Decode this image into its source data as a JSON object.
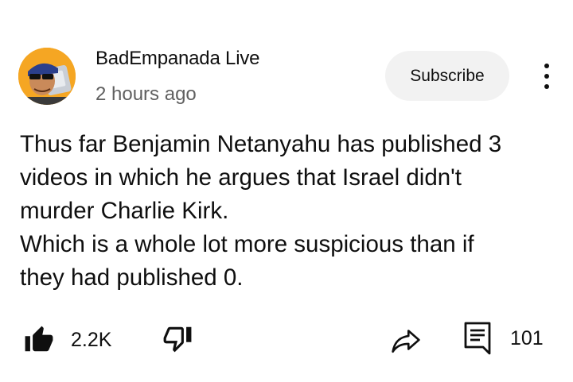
{
  "post": {
    "channel_name": "BadEmpanada Live",
    "timestamp": "2 hours ago",
    "subscribe_label": "Subscribe",
    "body_lines": [
      "Thus far Benjamin Netanyahu has published 3",
      "videos in which he argues that Israel didn't",
      "murder Charlie Kirk.",
      "Which is a whole lot more suspicious than if",
      "they had published 0."
    ]
  },
  "actions": {
    "like_count": "2.2K",
    "comment_count": "101"
  },
  "icons": {
    "avatar": "channel-avatar",
    "more": "more-vertical-icon",
    "like": "thumbs-up-filled-icon",
    "dislike": "thumbs-down-outline-icon",
    "share": "share-arrow-icon",
    "comments": "comment-icon"
  },
  "colors": {
    "text": "#0f0f0f",
    "secondary_text": "#606060",
    "subscribe_bg": "#f2f2f2",
    "avatar_bg": "#f5a623"
  }
}
